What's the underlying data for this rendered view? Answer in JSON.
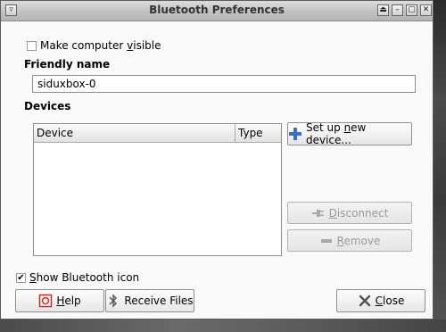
{
  "window": {
    "title": "Bluetooth Preferences",
    "controls": [
      "shade",
      "minimize",
      "maximize",
      "close"
    ]
  },
  "visibility": {
    "checkbox_checked": false,
    "label_pre": "Make computer ",
    "label_mnemonic": "v",
    "label_post": "isible"
  },
  "friendly_name": {
    "heading": "Friendly name",
    "value": "siduxbox-0"
  },
  "devices": {
    "heading": "Devices",
    "columns": [
      "Device",
      "Type"
    ],
    "rows": []
  },
  "buttons": {
    "setup": {
      "pre": "Set up ",
      "mnemonic": "n",
      "post": "ew device..."
    },
    "disconnect": {
      "mnemonic": "D",
      "post": "isconnect"
    },
    "remove": {
      "mnemonic": "R",
      "post": "emove"
    },
    "help": {
      "mnemonic": "H",
      "post": "elp"
    },
    "receive_files": "Receive Files",
    "close": {
      "mnemonic": "C",
      "post": "lose"
    }
  },
  "show_icon": {
    "checked": true,
    "mnemonic": "S",
    "post": "how Bluetooth icon"
  },
  "colors": {
    "titlebar": "#c4c4c4",
    "dialog_bg": "#f9f9f9",
    "setup_icon": "#3a6fc4",
    "help_icon": "#c62828"
  }
}
